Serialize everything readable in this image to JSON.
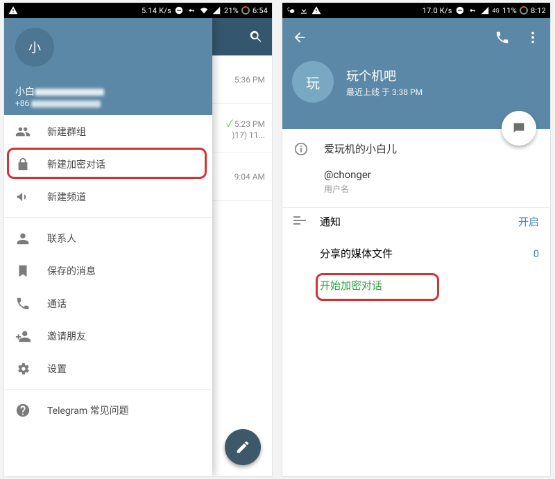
{
  "status_left": {
    "speed": "5.14 K/s",
    "battery": "21%",
    "clock": "6:54"
  },
  "status_right": {
    "speed": "17.0 K/s",
    "net": "4G",
    "battery": "11%",
    "clock": "8:12"
  },
  "drawer": {
    "avatar_letter": "小",
    "username": "小白",
    "phone_prefix": "+86",
    "items": {
      "new_group": "新建群组",
      "new_secret": "新建加密对话",
      "new_channel": "新建频道",
      "contacts": "联系人",
      "saved": "保存的消息",
      "calls": "通话",
      "invite": "邀请朋友",
      "settings": "设置",
      "faq": "Telegram 常见问题"
    }
  },
  "chatlist": {
    "rows": [
      {
        "time": "5:36 PM",
        "checked": false,
        "line2": ""
      },
      {
        "time": "5:23 PM",
        "checked": true,
        "line2": ")17) 11..."
      },
      {
        "time": "9:04 AM",
        "checked": false,
        "line2": ""
      }
    ]
  },
  "profile": {
    "avatar_letter": "玩",
    "title": "玩个机吧",
    "subtitle": "最近上线 于 3:38 PM",
    "bio": "爱玩机的小白儿",
    "handle": "@chonger",
    "handle_label": "用户名",
    "rows": {
      "notifications": {
        "label": "通知",
        "value": "开启"
      },
      "shared_media": {
        "label": "分享的媒体文件",
        "value": "0"
      },
      "start_secret": {
        "label": "开始加密对话"
      }
    }
  }
}
